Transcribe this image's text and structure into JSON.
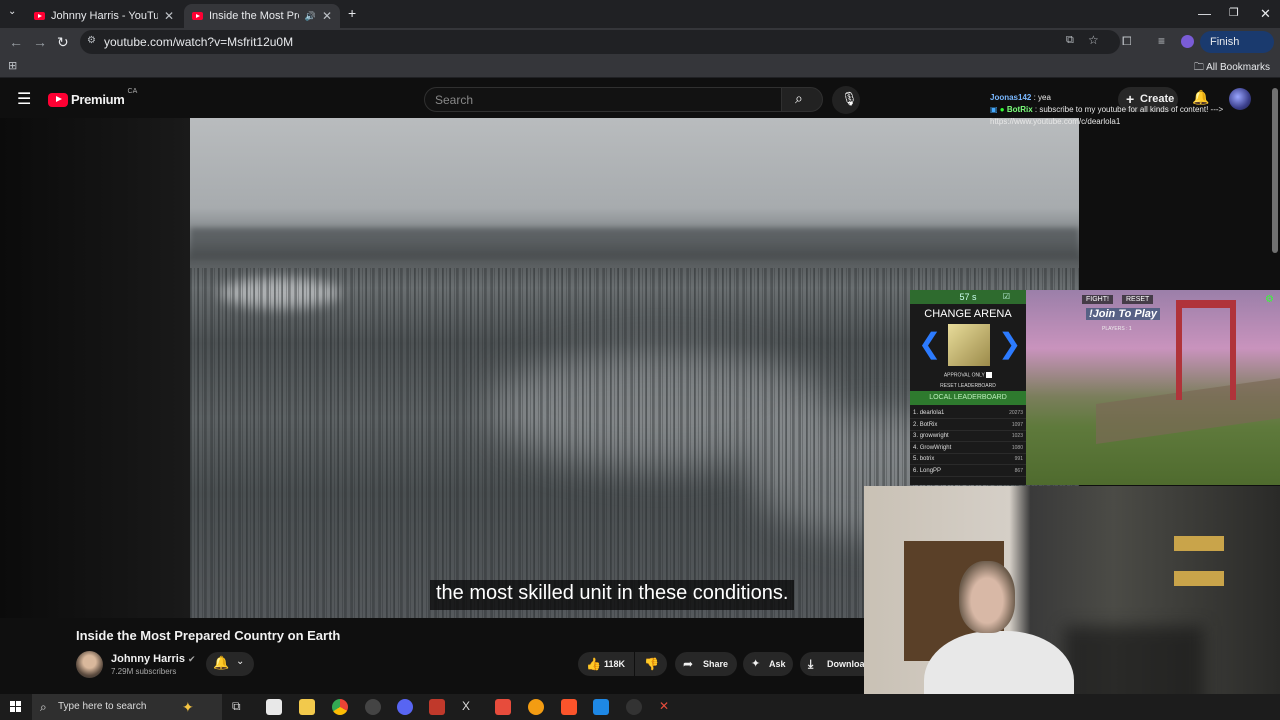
{
  "browser": {
    "tabs": [
      {
        "title": "Johnny Harris - YouTube"
      },
      {
        "title": "Inside the Most Prepared C"
      }
    ],
    "url": "youtube.com/watch?v=Msfrit12u0M",
    "finish_update": "Finish update",
    "all_bookmarks": "All Bookmarks"
  },
  "youtube": {
    "logo_word": "Premium",
    "logo_region": "CA",
    "search_placeholder": "Search",
    "create_label": "Create"
  },
  "video": {
    "subtitle": "the most skilled unit in these conditions.",
    "title": "Inside the Most Prepared Country on Earth",
    "channel": "Johnny Harris",
    "subscribers": "7.29M subscribers",
    "likes": "118K",
    "share_label": "Share",
    "ask_label": "Ask",
    "download_label": "Downloa"
  },
  "stream_chat": [
    {
      "user": "Joonas142",
      "message": " : yea"
    },
    {
      "user": "BotRix",
      "message": " : subscribe to my youtube for all kinds of content! ---> https://www.youtube.com/c/dearlola1"
    }
  ],
  "game": {
    "timer": "57 s",
    "change_arena": "CHANGE ARENA",
    "approval_only": "APPROVAL ONLY",
    "reset_leaderboard": "RESET LEADERBOARD",
    "local_leaderboard": "LOCAL LEADERBOARD",
    "fight": "FIGHT!",
    "reset": "RESET",
    "join": "!Join To Play",
    "players": "PLAYERS : 1",
    "leaderboard": [
      {
        "rank": "1.",
        "name": "dearlola1",
        "score": "20273"
      },
      {
        "rank": "2.",
        "name": "BotRix",
        "score": "1097"
      },
      {
        "rank": "3.",
        "name": "growwright",
        "score": "1023"
      },
      {
        "rank": "4.",
        "name": "GrowWright",
        "score": "1080"
      },
      {
        "rank": "5.",
        "name": "botrix",
        "score": "991"
      },
      {
        "rank": "6.",
        "name": "LongPP",
        "score": "867"
      }
    ]
  },
  "taskbar": {
    "search_placeholder": "Type here to search"
  },
  "colors": {
    "youtube_red": "#ff0033",
    "arena_green": "#2e7a2e",
    "arrow_blue": "#2c7bff"
  }
}
